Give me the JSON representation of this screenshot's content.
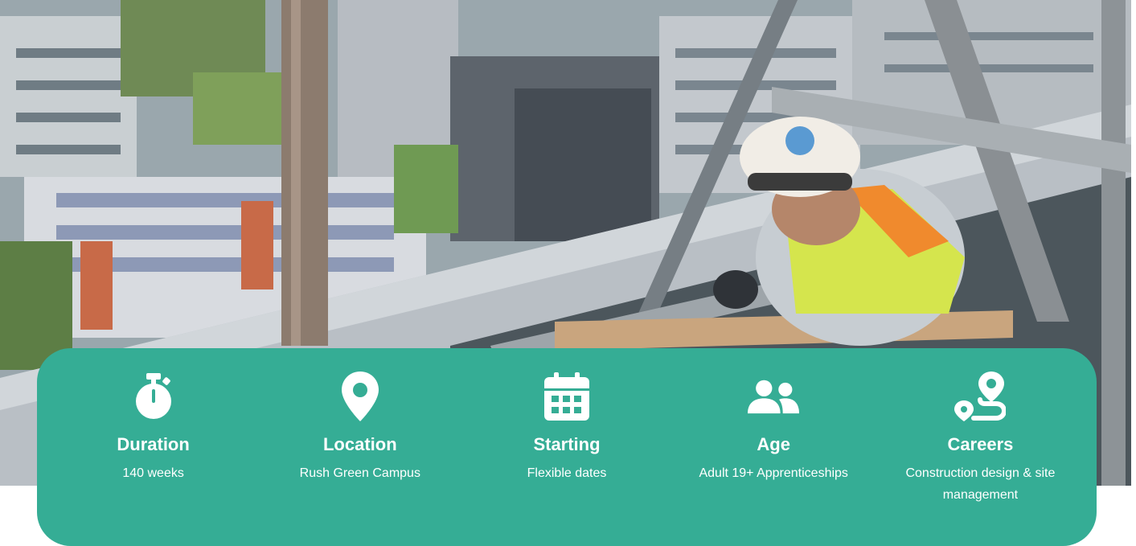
{
  "hero": {
    "icon": "construction-worker-photo"
  },
  "info": {
    "items": [
      {
        "icon": "stopwatch-icon",
        "label": "Duration",
        "value": "140 weeks"
      },
      {
        "icon": "map-pin-icon",
        "label": "Location",
        "value": "Rush Green Campus"
      },
      {
        "icon": "calendar-icon",
        "label": "Starting",
        "value": "Flexible dates"
      },
      {
        "icon": "users-icon",
        "label": "Age",
        "value": "Adult 19+ Apprenticeships"
      },
      {
        "icon": "route-icon",
        "label": "Careers",
        "value": "Construction design & site management"
      }
    ]
  },
  "colors": {
    "accent": "#35ad95",
    "text": "#ffffff"
  }
}
